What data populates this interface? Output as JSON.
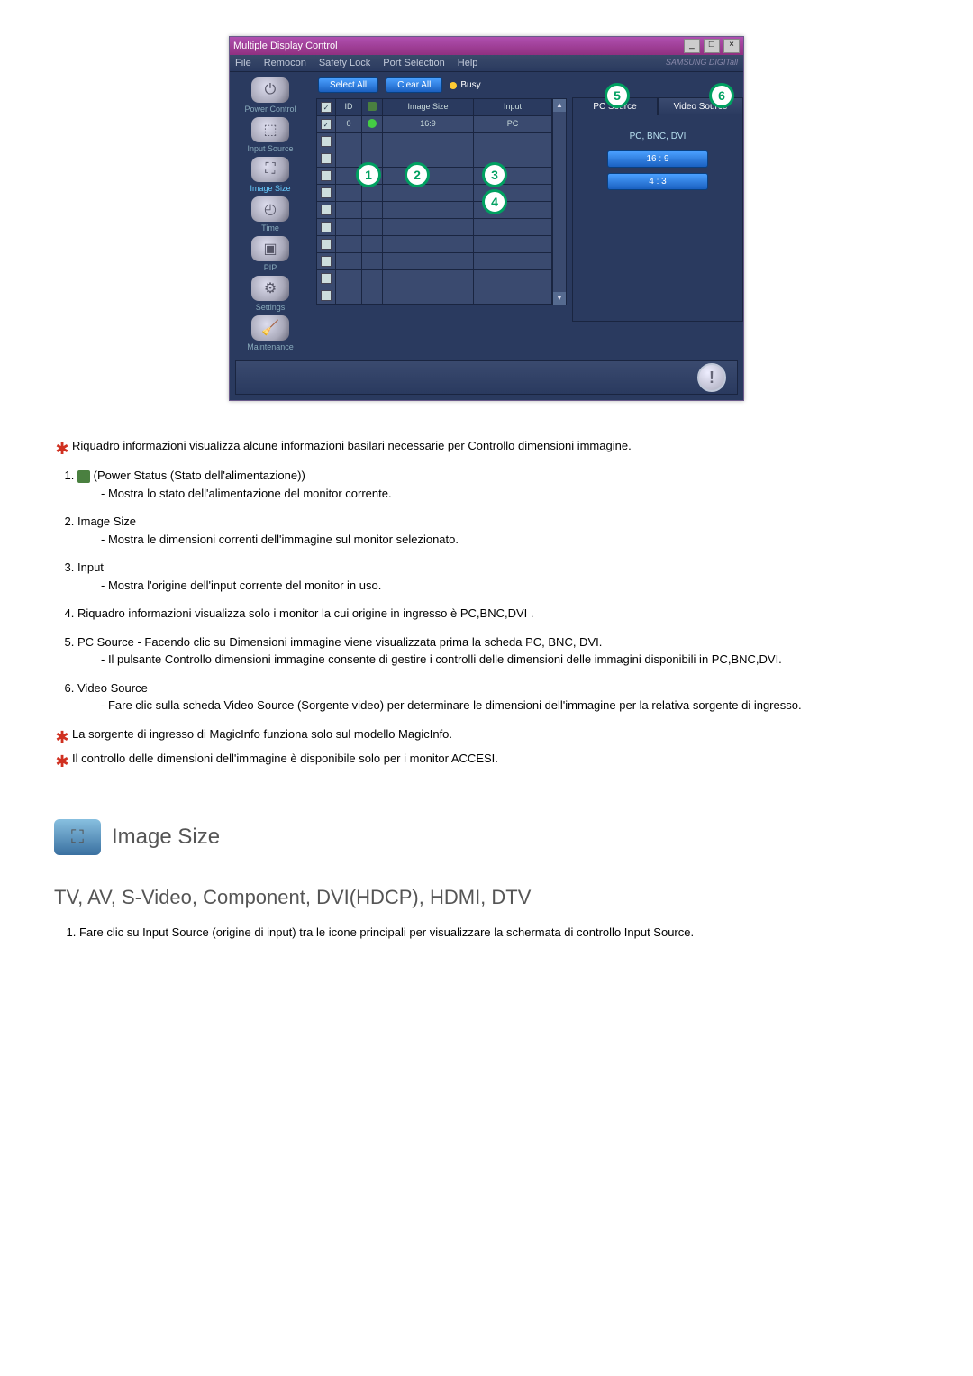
{
  "window": {
    "title": "Multiple Display Control",
    "menu": {
      "file": "File",
      "remocon": "Remocon",
      "safety_lock": "Safety Lock",
      "port_selection": "Port Selection",
      "help": "Help",
      "brand": "SAMSUNG DIGITall"
    }
  },
  "sidebar": {
    "items": [
      {
        "label": "Power Control",
        "icon": "power-icon"
      },
      {
        "label": "Input Source",
        "icon": "input-source-icon"
      },
      {
        "label": "Image Size",
        "icon": "image-size-icon",
        "active": true
      },
      {
        "label": "Time",
        "icon": "time-icon"
      },
      {
        "label": "PIP",
        "icon": "pip-icon"
      },
      {
        "label": "Settings",
        "icon": "settings-icon"
      },
      {
        "label": "Maintenance",
        "icon": "maintenance-icon"
      }
    ]
  },
  "actions": {
    "select_all": "Select All",
    "clear_all": "Clear All",
    "busy": "Busy"
  },
  "grid": {
    "headers": {
      "id": "ID",
      "image_size": "Image Size",
      "input": "Input"
    },
    "row0": {
      "id": "0",
      "image_size": "16:9",
      "input": "PC",
      "checked": true,
      "power_on": true
    }
  },
  "right": {
    "tab_pc": "PC Source",
    "tab_video": "Video Source",
    "label_mode": "PC, BNC, DVI",
    "btn_169": "16 : 9",
    "btn_43": "4 : 3"
  },
  "notes": {
    "intro": "Riquadro informazioni visualizza alcune informazioni basilari necessarie per Controllo dimensioni immagine.",
    "n1_label": "(Power Status (Stato dell'alimentazione))",
    "n1_body": "- Mostra lo stato dell'alimentazione del monitor corrente.",
    "n2_title": "Image Size",
    "n2_body": "- Mostra le dimensioni correnti dell'immagine sul monitor selezionato.",
    "n3_title": "Input",
    "n3_body": "- Mostra l'origine dell'input corrente del monitor in uso.",
    "n4_body": "Riquadro informazioni visualizza solo i monitor la cui origine in ingresso è PC,BNC,DVI .",
    "n5_title": "PC Source - Facendo clic su Dimensioni immagine viene visualizzata prima la scheda PC, BNC, DVI.",
    "n5_body": "- Il pulsante Controllo dimensioni immagine consente di gestire i controlli delle dimensioni delle immagini disponibili in PC,BNC,DVI.",
    "n6_title": "Video Source",
    "n6_body": "- Fare clic sulla scheda Video Source (Sorgente video) per determinare le dimensioni dell'immagine per la relativa sorgente di ingresso.",
    "star2": "La sorgente di ingresso di MagicInfo funziona solo sul modello MagicInfo.",
    "star3": "Il controllo delle dimensioni dell'immagine è disponibile solo per i monitor ACCESI."
  },
  "section": {
    "title": "Image Size",
    "subtitle": "TV, AV, S-Video, Component, DVI(HDCP), HDMI, DTV",
    "step1": "Fare clic su Input Source (origine di input) tra le icone principali per visualizzare la schermata di controllo Input Source."
  }
}
